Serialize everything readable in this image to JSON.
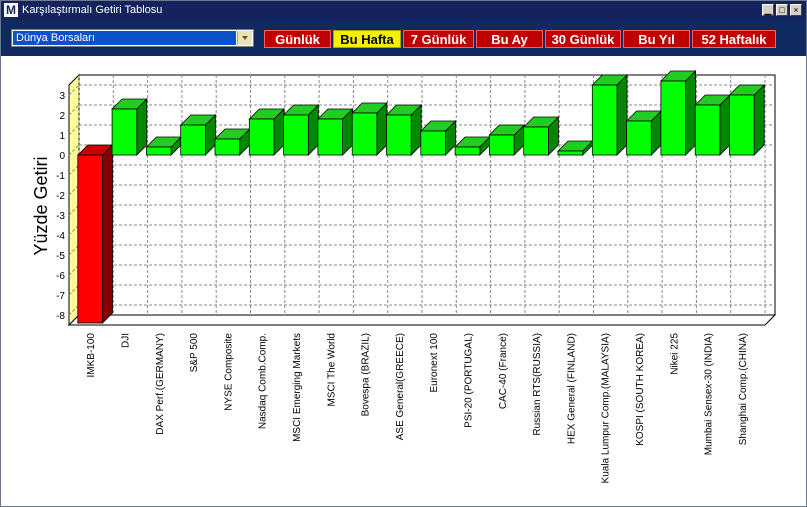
{
  "window": {
    "title": "Karşılaştırmalı Getiri Tablosu",
    "icon_letter": "M"
  },
  "toolbar": {
    "market_select": "Dünya Borsaları",
    "periods": [
      {
        "label": "Günlük",
        "active": false
      },
      {
        "label": "Bu Hafta",
        "active": true
      },
      {
        "label": "7 Günlük",
        "active": false
      },
      {
        "label": "Bu Ay",
        "active": false
      },
      {
        "label": "30 Günlük",
        "active": false
      },
      {
        "label": "Bu Yıl",
        "active": false
      },
      {
        "label": "52 Haftalık",
        "active": false
      }
    ]
  },
  "colors": {
    "positive": "#00ff00",
    "negative": "#ff0000",
    "active_period": "#f5f000",
    "period": "#c00000"
  },
  "chart_data": {
    "type": "bar",
    "ylabel": "Yüzde Getiri",
    "ylim": [
      -8.5,
      3.5
    ],
    "yticks": [
      3,
      2,
      1,
      0,
      -1,
      -2,
      -3,
      -4,
      -5,
      -6,
      -7,
      -8
    ],
    "grid": true,
    "categories": [
      "IMKB-100",
      "DJI",
      "DAX Perf.(GERMANY)",
      "S&P 500",
      "NYSE Composite",
      "Nasdaq Comb.Comp.",
      "MSCI Emerging Markets",
      "MSCI The World",
      "Bovespa (BRAZIL)",
      "ASE General(GREECE)",
      "Euronext 100",
      "PSI-20 (PORTUGAL)",
      "CAC-40 (France)",
      "Russian RTS(RUSSIA)",
      "HEX General (FINLAND)",
      "Kuala Lumpur Comp.(MALAYSIA)",
      "KOSPI (SOUTH KOREA)",
      "Nikei 225",
      "Mumbai Sensex-30 (INDIA)",
      "Shanghai Comp.(CHINA)"
    ],
    "values": [
      -8.4,
      2.3,
      0.4,
      1.5,
      0.8,
      1.8,
      2.0,
      1.8,
      2.1,
      2.0,
      1.2,
      0.4,
      1.0,
      1.4,
      0.2,
      3.5,
      1.7,
      3.7,
      2.5,
      3.0
    ]
  }
}
